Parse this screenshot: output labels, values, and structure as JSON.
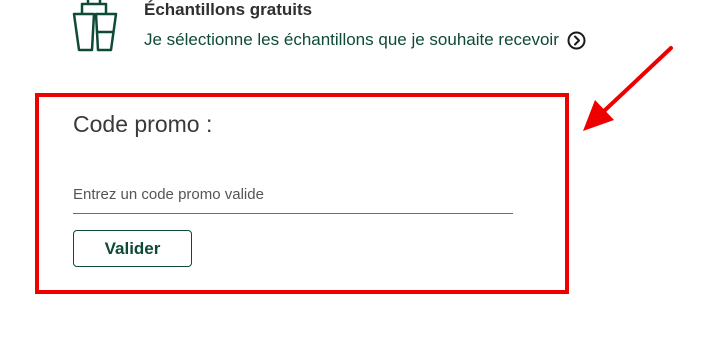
{
  "samples": {
    "icon": "product-samples-icon",
    "title": "Échantillons gratuits",
    "link_text": "Je sélectionne les échantillons que je souhaite recevoir",
    "link_icon": "chevron-right-circle-icon"
  },
  "promo": {
    "title": "Code promo :",
    "input_placeholder": "Entrez un code promo valide",
    "input_value": "",
    "submit_label": "Valider"
  },
  "colors": {
    "brand_green": "#0e4a36",
    "annotation_red": "#ee0000"
  }
}
